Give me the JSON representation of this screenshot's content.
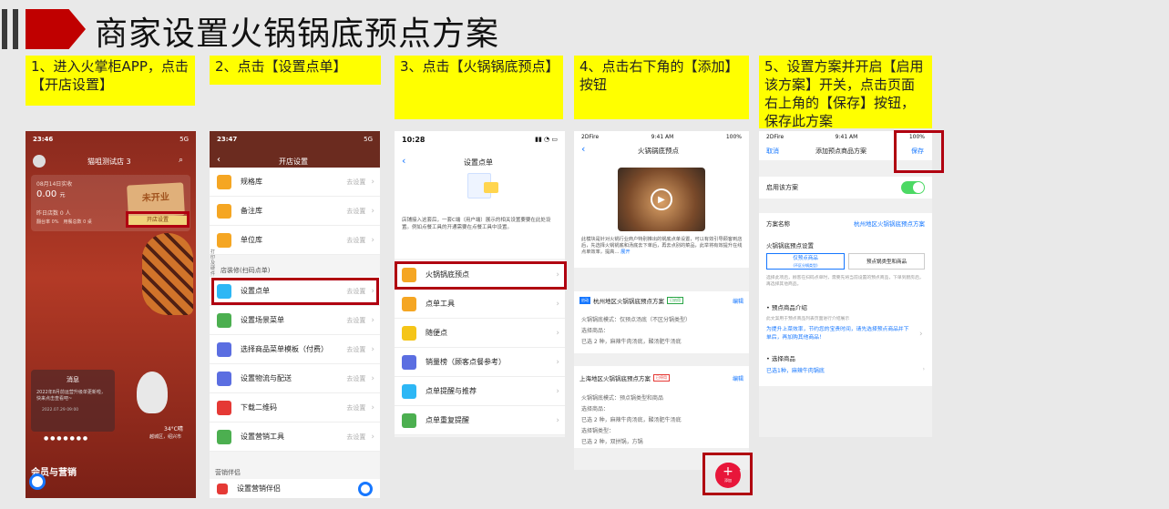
{
  "page": {
    "title": "商家设置火锅锅底预点方案"
  },
  "steps": [
    "1、进入火掌柜APP，点击【开店设置】",
    "2、点击【设置点单】",
    "3、点击【火锅锅底预点】",
    "4、点击右下角的【添加】按钮",
    "5、设置方案并开启【启用该方案】开关，点击页面右上角的【保存】按钮，保存此方案"
  ],
  "phone1": {
    "time": "23:46",
    "signal": "5G",
    "store": "猫咀测试店 3",
    "date_label": "08月14日实收",
    "amount": "0.00",
    "amount_unit": "元",
    "today_orders": "昨日店数 0 人",
    "stats": "翻台率 0%　用餐总数 0 桌",
    "badge": "未开业",
    "shop_setting": "开店设置",
    "msg_title": "消息",
    "msg_body": "2022年8月前运营升级单更新啦，快来点击查看吧~",
    "msg_time": "2022.07.29 09:00",
    "weather": "34°C晴",
    "location": "越城区，绍兴市",
    "section": "会员与营销"
  },
  "phone2": {
    "time": "23:47",
    "title": "开店设置",
    "side_label": "打印及硬件管理",
    "hint": "去设置",
    "items_top": [
      {
        "label": "规格库",
        "icon": "#f5a623"
      },
      {
        "label": "备注库",
        "icon": "#f5a623"
      },
      {
        "label": "单位库",
        "icon": "#f5a623"
      }
    ],
    "group": "店装修(扫码点单)",
    "items": [
      {
        "label": "设置点单",
        "icon": "#2db7f5"
      },
      {
        "label": "设置场景菜单",
        "icon": "#4caf50"
      },
      {
        "label": "选择商品菜单模板（付费）",
        "icon": "#5b6ee1"
      },
      {
        "label": "设置物流与配送",
        "icon": "#5b6ee1"
      },
      {
        "label": "下载二维码",
        "icon": "#e53935"
      },
      {
        "label": "设置营销工具",
        "icon": "#4caf50"
      }
    ],
    "group2": "营销伴侣",
    "last_item": "设置营销伴侣"
  },
  "phone3": {
    "time": "10:28",
    "title": "设置点单",
    "desc": "店铺接入这套后，一套C端（用户端）展示的相关设置要要在此处设置。例如点餐工具的开通需要在点餐工具中设置。",
    "items": [
      {
        "label": "火锅锅底预点",
        "icon": "#f5a623"
      },
      {
        "label": "点单工具",
        "icon": "#f5a623"
      },
      {
        "label": "随便点",
        "icon": "#f5c518"
      },
      {
        "label": "销量榜（顾客点餐参考）",
        "icon": "#5b6ee1"
      },
      {
        "label": "点单提醒与推荐",
        "icon": "#2db7f5"
      },
      {
        "label": "点单重复提醒",
        "icon": "#4caf50"
      }
    ]
  },
  "phone4": {
    "carrier": "2DFire",
    "time": "9:41 AM",
    "battery": "100%",
    "title": "火锅锅底预点",
    "intro": "此模块是针对火锅行业商户特别推出的锅底点单设置，可以有效引导顾客到店后，先选择火锅锅底和汤底去下单后，再去点别的菜品，此举将有效提升在线点单效率，提高…",
    "expand": "展开",
    "plan1": {
      "tag": "启动",
      "title": "杭州地区火锅锅底预点方案",
      "status": "已启用",
      "edit": "编辑",
      "mode": "火锅锅底模式：仅预点汤底（不区分锅类型）",
      "goods_label": "选择商品：",
      "goods": "已选 2 种，麻辣牛肉汤底，酸汤肥牛汤底"
    },
    "plan2": {
      "title": "上海地区火锅锅底预点方案",
      "status": "已停用",
      "edit": "编辑",
      "mode": "火锅锅底模式：预点锅类型和商品",
      "goods_label": "选择商品：",
      "goods": "已选 2 种，麻辣牛肉汤底，酸汤肥牛汤底",
      "pot_label": "选择锅类型：",
      "pot": "已选 2 种，双拼锅，方锅"
    },
    "add": "添加"
  },
  "phone5": {
    "carrier": "2DFire",
    "time": "9:41 AM",
    "battery": "100%",
    "cancel": "取消",
    "title": "添加预点商品方案",
    "save": "保存",
    "enable_label": "启用该方案",
    "name_label": "方案名称",
    "name_value": "杭州地区火锅锅底预点方案",
    "mode_label": "火锅锅底预点设置",
    "opt1": "仅预点商品",
    "opt1_sub": "(不区分锅类型)",
    "opt2": "预点锅类型和商品",
    "mode_hint": "选择此项后，顾客在扫码点单时，需要先将当前设置的预点商品，下单到厨房后，再选择其他商品。",
    "intro_label": "预点商品介绍",
    "intro_hint": "此文案用于预点商品列表页面进行介绍展示",
    "intro_value": "为提升上菜效率，节约您的宝贵时间，请先选择预点商品并下单后，再加购其他商品！",
    "goods_label": "选择商品",
    "goods_value": "已选1种，麻辣牛肉锅底"
  }
}
